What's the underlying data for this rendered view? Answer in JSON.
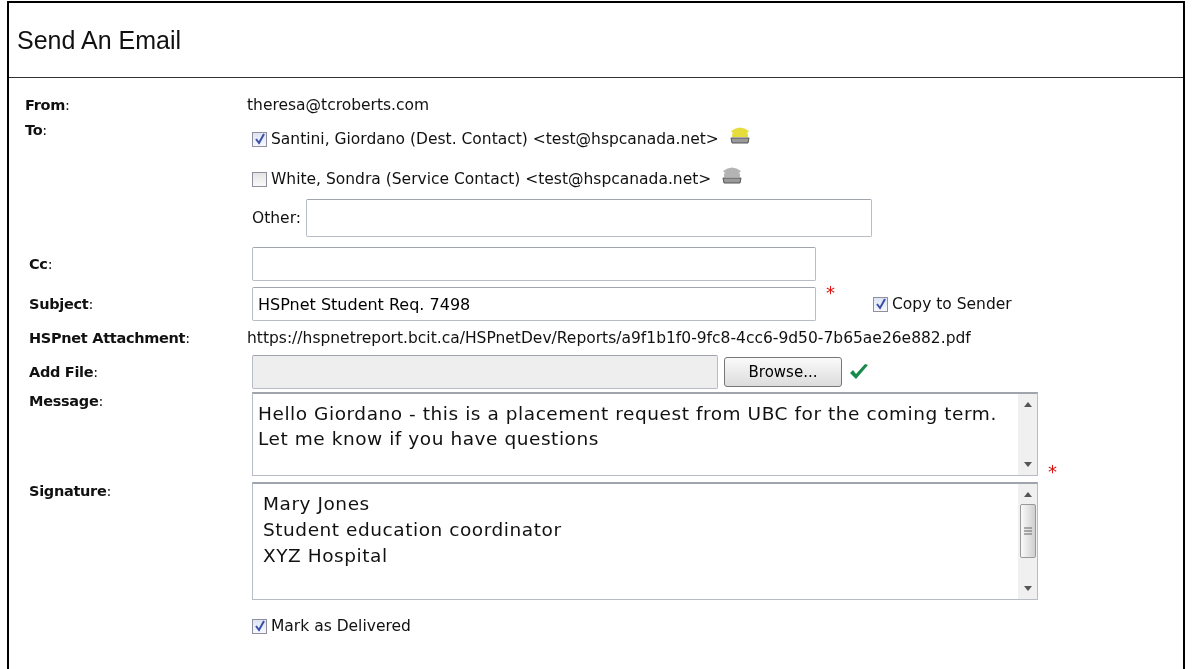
{
  "title": "Send An Email",
  "fields": [
    {
      "kind": "text",
      "label": "**From**:",
      "value": "theresa@tcroberts.com"
    },
    {
      "kind": "recipients",
      "label": "**To**:",
      "recipients": [
        {
          "text": "Santini, Giordano (Dest. Contact) <test@hspcanada.net>",
          "checked": true,
          "color": "#e6dc3c"
        },
        {
          "text": "White, Sondra (Service Contact) <test@hspcanada.net>",
          "checked": false,
          "color": "#b4b4b4"
        }
      ],
      "other_label": "Other:"
    },
    {
      "kind": "input",
      "label": "**Cc**:"
    },
    {
      "kind": "input",
      "label": "**Subject**:",
      "value": "HSPnet Student Req. 7498",
      "required_mark": "*",
      "option": {
        "label": "Copy to Sender",
        "checked": true
      }
    },
    {
      "kind": "text",
      "label": "**HSPnet Attachment**:",
      "value": "https://hspnetreport.bcit.ca/HSPnetDev/Reports/a9f1b1f0-9fc8-4cc6-9d50-7b65ae26e882.pdf"
    },
    {
      "kind": "file",
      "label": "**Add File**:",
      "button": "Browse...",
      "valid": true
    },
    {
      "kind": "textarea",
      "label": "**Message**:",
      "lines": [
        "Hello Giordano - this is a placement request from UBC for the coming term.   Let me know if you have questions"
      ],
      "required_mark": "*",
      "scroll_thumb": false
    },
    {
      "kind": "textarea",
      "label": "**Signature**:",
      "lines": [
        "Mary Jones",
        "Student education coordinator",
        "XYZ Hospital"
      ],
      "scroll_thumb": true
    },
    {
      "kind": "checkbox",
      "option": {
        "label": "Mark as Delivered",
        "checked": true
      }
    }
  ]
}
